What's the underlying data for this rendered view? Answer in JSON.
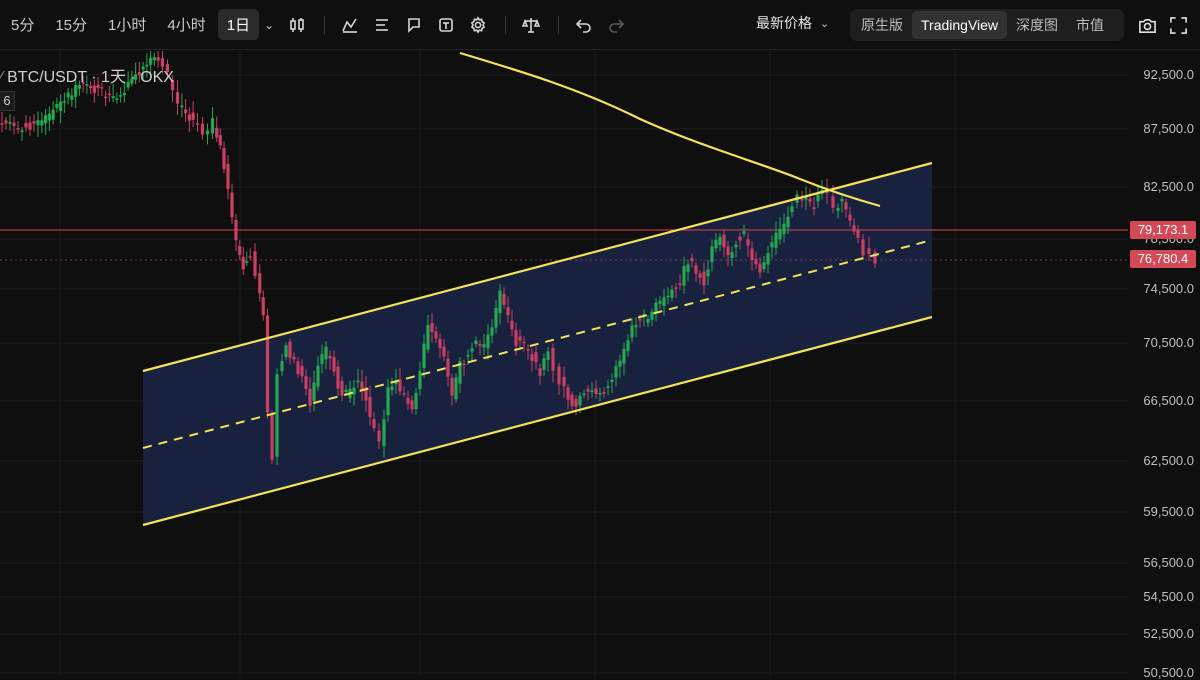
{
  "toolbar": {
    "timeframes": [
      {
        "label": "5分",
        "active": false
      },
      {
        "label": "15分",
        "active": false
      },
      {
        "label": "1小时",
        "active": false
      },
      {
        "label": "4小时",
        "active": false
      },
      {
        "label": "1日",
        "active": true
      }
    ],
    "tools": [
      "candle-type-icon",
      "indicators-icon",
      "drawing-lines-icon",
      "replay-icon",
      "alerts-icon",
      "settings-icon",
      "compare-icon",
      "undo-icon",
      "redo-icon"
    ],
    "price_type": "最新价格",
    "views": [
      {
        "label": "原生版",
        "active": false
      },
      {
        "label": "TradingView",
        "active": true
      },
      {
        "label": "深度图",
        "active": false
      },
      {
        "label": "市值",
        "active": false
      }
    ],
    "right_icons": [
      "screenshot-icon",
      "fullscreen-icon"
    ]
  },
  "chart": {
    "symbol": "BTC/USDT · 1天 · OKX",
    "pane_badge": "6",
    "colors": {
      "up": "#25a750",
      "down": "#ca3f64",
      "channel": "#f2e35a",
      "channel_fill": "#1a2547",
      "ma": "#f2e35a",
      "horizontal": "#e0464c",
      "background": "#0f0f0f"
    }
  },
  "price_axis": {
    "labels": [
      "92,500.0",
      "87,500.0",
      "82,500.0",
      "78,500.0",
      "74,500.0",
      "70,500.0",
      "66,500.0",
      "62,500.0",
      "59,500.0",
      "56,500.0",
      "54,500.0",
      "52,500.0",
      "50,500.0"
    ],
    "badges": [
      {
        "text": "79,173.1",
        "color": "#d34a56",
        "value": 79173.1
      },
      {
        "text": "76,780.4",
        "color": "#d34a56",
        "value": 76780.4
      }
    ]
  }
}
